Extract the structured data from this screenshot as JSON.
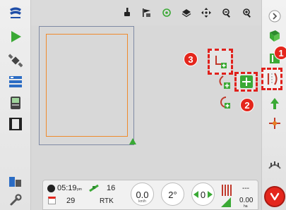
{
  "left_bar": {
    "logo": "topcon-logo",
    "items": [
      "play-icon",
      "satellite-icon",
      "layers-list-icon",
      "display-icon",
      "film-icon",
      "sections-icon",
      "wrench-icon"
    ]
  },
  "top_bar": {
    "icons": [
      "hand-pointer-icon",
      "flag-icon",
      "target-icon",
      "layers-icon",
      "pan-icon",
      "zoom-out-icon",
      "zoom-in-icon"
    ]
  },
  "callouts": {
    "one": "1",
    "two": "2",
    "three": "3"
  },
  "status": {
    "time": "05:19",
    "time_unit": "pm",
    "satellites": "16",
    "date": "29",
    "rtk": "RTK",
    "speed": "0.0",
    "speed_unit": "km/h",
    "heading": "2°",
    "offset": "0",
    "rate_top": "---",
    "rate": "0.00",
    "rate_unit": "ha"
  },
  "colors": {
    "accent_green": "#3aa935",
    "alert_red": "#e4261c",
    "field_boundary": "#ef8a2c",
    "field_outer": "#7f8aa4"
  }
}
